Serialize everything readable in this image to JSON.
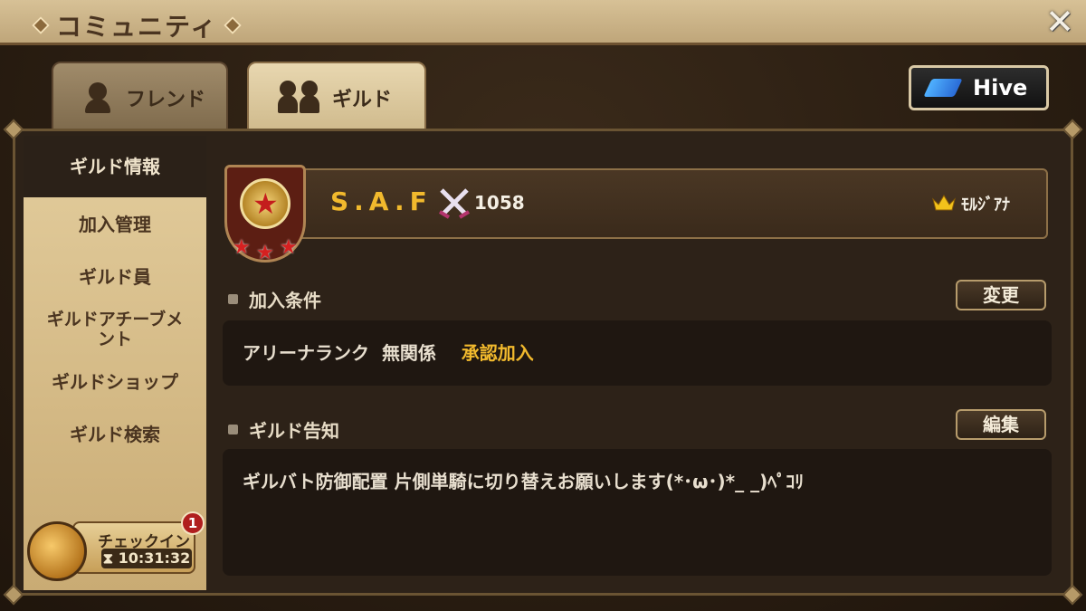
{
  "window": {
    "title": "コミュニティ",
    "close_symbol": "✕"
  },
  "tabs": [
    {
      "label": "フレンド",
      "active": false
    },
    {
      "label": "ギルド",
      "active": true
    }
  ],
  "hive_button": {
    "label": "Hive"
  },
  "sidebar": {
    "items": [
      {
        "label": "ギルド情報",
        "active": true
      },
      {
        "label": "加入管理"
      },
      {
        "label": "ギルド員"
      },
      {
        "label": "ギルドアチーブメ\nント"
      },
      {
        "label": "ギルドショップ"
      },
      {
        "label": "ギルド検索"
      }
    ]
  },
  "checkin": {
    "label": "チェックイン",
    "timer": "10:31:32",
    "badge_count": "1",
    "hourglass": "⧗"
  },
  "guild": {
    "name": "S.A.F",
    "score": "1058",
    "leader": "ﾓﾙｼﾞｱﾅ",
    "emblem_star": "★",
    "rank_stars": [
      "★",
      "★",
      "★"
    ]
  },
  "sections": {
    "join_conditions": {
      "label": "加入条件",
      "button": "変更",
      "arena_rank": "アリーナランク",
      "rank_value": "無関係",
      "approval": "承認加入"
    },
    "notice": {
      "label": "ギルド告知",
      "button": "編集",
      "text": "ギルバト防御配置 片側単騎に切り替えお願いします(*･ω･)*_ _)ﾍﾟｺﾘ"
    }
  },
  "colors": {
    "accent_gold": "#f1b92d",
    "title_bar": "#d7c196",
    "badge_red": "#b01e1e"
  }
}
